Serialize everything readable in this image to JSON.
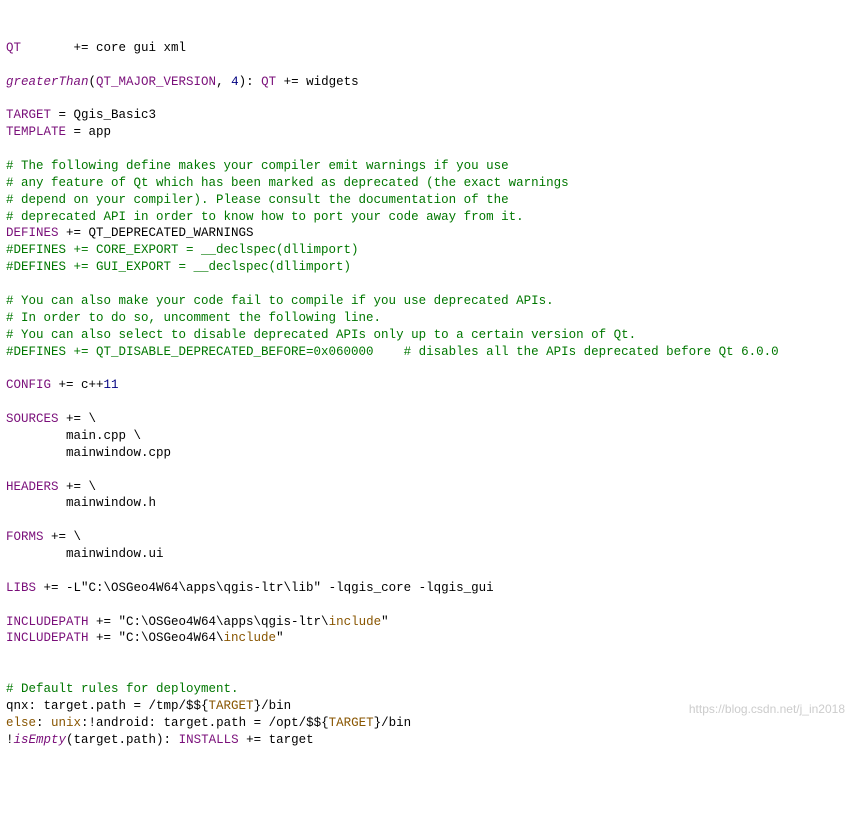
{
  "code": {
    "l01a": "QT",
    "l01b": "       += core gui xml",
    "l02": "",
    "l03a": "greaterThan",
    "l03b": "(",
    "l03c": "QT_MAJOR_VERSION",
    "l03d": ", ",
    "l03e": "4",
    "l03f": "): ",
    "l03g": "QT",
    "l03h": " += widgets",
    "l04": "",
    "l05a": "TARGET",
    "l05b": " = Qgis_Basic3",
    "l06a": "TEMPLATE",
    "l06b": " = app",
    "l07": "",
    "l08": "# The following define makes your compiler emit warnings if you use",
    "l09": "# any feature of Qt which has been marked as deprecated (the exact warnings",
    "l10": "# depend on your compiler). Please consult the documentation of the",
    "l11": "# deprecated API in order to know how to port your code away from it.",
    "l12a": "DEFINES",
    "l12b": " += QT_DEPRECATED_WARNINGS",
    "l13": "#DEFINES += CORE_EXPORT = __declspec(dllimport)",
    "l14": "#DEFINES += GUI_EXPORT = __declspec(dllimport)",
    "l15": "",
    "l16": "# You can also make your code fail to compile if you use deprecated APIs.",
    "l17": "# In order to do so, uncomment the following line.",
    "l18": "# You can also select to disable deprecated APIs only up to a certain version of Qt.",
    "l19": "#DEFINES += QT_DISABLE_DEPRECATED_BEFORE=0x060000    # disables all the APIs deprecated before Qt 6.0.0",
    "l20": "",
    "l21a": "CONFIG",
    "l21b": " += c++",
    "l21c": "11",
    "l22": "",
    "l23a": "SOURCES",
    "l23b": " += \\",
    "l24": "        main.cpp \\",
    "l25": "        mainwindow.cpp",
    "l26": "",
    "l27a": "HEADERS",
    "l27b": " += \\",
    "l28": "        mainwindow.h",
    "l29": "",
    "l30a": "FORMS",
    "l30b": " += \\",
    "l31": "        mainwindow.ui",
    "l32": "",
    "l33a": "LIBS",
    "l33b": " += -L\"C:\\OSGeo4W64\\apps\\qgis-ltr\\lib\" -lqgis_core -lqgis_gui",
    "l34": "",
    "l35a": "INCLUDEPATH",
    "l35b": " += \"C:\\OSGeo4W64\\apps\\qgis-ltr\\",
    "l35c": "include",
    "l35d": "\"",
    "l36a": "INCLUDEPATH",
    "l36b": " += \"C:\\OSGeo4W64\\",
    "l36c": "include",
    "l36d": "\"",
    "l37": "",
    "l38": "",
    "l39": "# Default rules for deployment.",
    "l40a": "qnx: target.path = /tmp/$${",
    "l40b": "TARGET",
    "l40c": "}/bin",
    "l41a": "else",
    "l41b": ": ",
    "l41c": "unix",
    "l41d": ":!android: target.path = /opt/$${",
    "l41e": "TARGET",
    "l41f": "}/bin",
    "l42a": "!",
    "l42b": "isEmpty",
    "l42c": "(target.path): ",
    "l42d": "INSTALLS",
    "l42e": " += target"
  },
  "watermark": "https://blog.csdn.net/j_in2018"
}
